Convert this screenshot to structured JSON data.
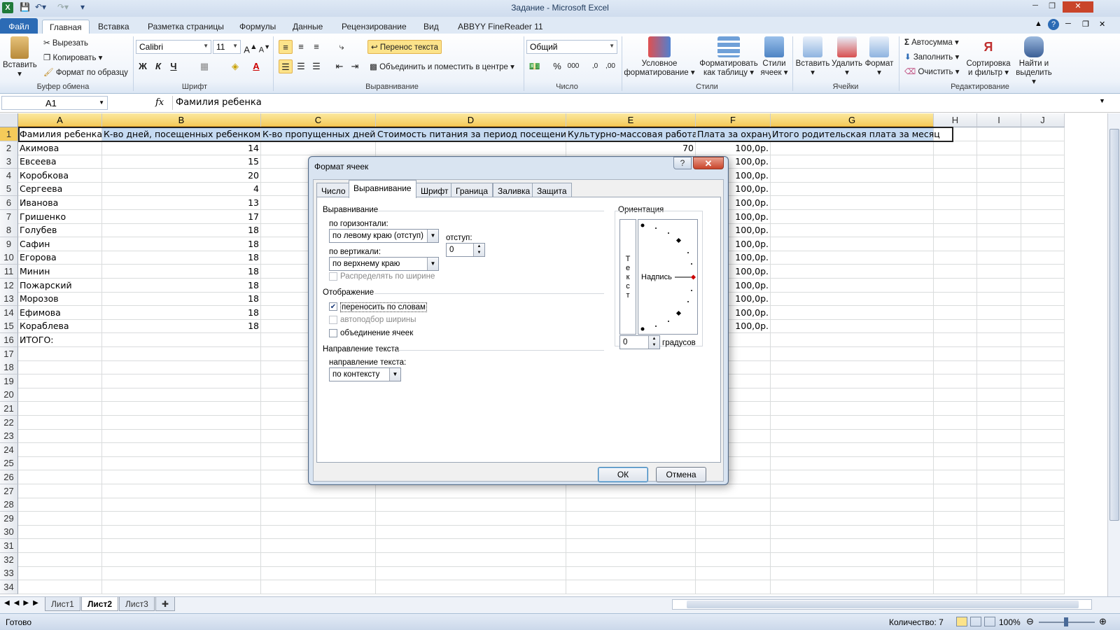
{
  "window": {
    "title": "Задание - Microsoft Excel"
  },
  "ribbon_tabs": [
    "Файл",
    "Главная",
    "Вставка",
    "Разметка страницы",
    "Формулы",
    "Данные",
    "Рецензирование",
    "Вид",
    "ABBYY FineReader 11"
  ],
  "ribbon": {
    "clipboard": {
      "paste": "Вставить",
      "cut": "Вырезать",
      "copy": "Копировать",
      "format_painter": "Формат по образцу",
      "group": "Буфер обмена"
    },
    "font": {
      "name": "Calibri",
      "size": "11",
      "bold": "Ж",
      "italic": "К",
      "underline": "Ч",
      "group": "Шрифт"
    },
    "alignment": {
      "wrap": "Перенос текста",
      "merge": "Объединить и поместить в центре",
      "group": "Выравнивание"
    },
    "number": {
      "format": "Общий",
      "percent": "%",
      "thousands": "000",
      "group": "Число"
    },
    "styles": {
      "conditional": "Условное форматирование",
      "as_table": "Форматировать как таблицу",
      "cell_styles": "Стили ячеек",
      "group": "Стили"
    },
    "cells": {
      "insert": "Вставить",
      "delete": "Удалить",
      "format": "Формат",
      "group": "Ячейки"
    },
    "editing": {
      "autosum": "Автосумма",
      "fill": "Заполнить",
      "clear": "Очистить",
      "sort": "Сортировка и фильтр",
      "find": "Найти и выделить",
      "group": "Редактирование"
    }
  },
  "formula_bar": {
    "name_box": "A1",
    "fx": "fx",
    "value": "Фамилия ребенка"
  },
  "columns": [
    "A",
    "B",
    "C",
    "D",
    "E",
    "F",
    "G",
    "H",
    "I",
    "J"
  ],
  "header_row": [
    "Фамилия ребенка",
    "К-во дней, посещенных ребенком",
    "К-во пропущенных дней",
    "Стоимость питания за период посещения",
    "Культурно-массовая работа",
    "Плата за охрану",
    "Итого родительская плата за месяц"
  ],
  "rows": [
    {
      "name": "Акимова",
      "days": "14",
      "culture": "70",
      "guard": "100,0р."
    },
    {
      "name": "Евсеева",
      "days": "15",
      "culture": "",
      "guard": "100,0р."
    },
    {
      "name": "Коробкова",
      "days": "20",
      "culture": "",
      "guard": "100,0р."
    },
    {
      "name": "Сергеева",
      "days": "4",
      "culture": "",
      "guard": "100,0р."
    },
    {
      "name": "Иванова",
      "days": "13",
      "culture": "",
      "guard": "100,0р."
    },
    {
      "name": "Гришенко",
      "days": "17",
      "culture": "",
      "guard": "100,0р."
    },
    {
      "name": "Голубев",
      "days": "18",
      "culture": "",
      "guard": "100,0р."
    },
    {
      "name": "Сафин",
      "days": "18",
      "culture": "",
      "guard": "100,0р."
    },
    {
      "name": "Егорова",
      "days": "18",
      "culture": "",
      "guard": "100,0р."
    },
    {
      "name": "Минин",
      "days": "18",
      "culture": "",
      "guard": "100,0р."
    },
    {
      "name": "Пожарский",
      "days": "18",
      "culture": "",
      "guard": "100,0р."
    },
    {
      "name": "Морозов",
      "days": "18",
      "culture": "",
      "guard": "100,0р."
    },
    {
      "name": "Ефимова",
      "days": "18",
      "culture": "",
      "guard": "100,0р."
    },
    {
      "name": "Кораблева",
      "days": "18",
      "culture": "",
      "guard": "100,0р."
    }
  ],
  "total_label": "ИТОГО:",
  "row_numbers": [
    "1",
    "2",
    "3",
    "4",
    "5",
    "6",
    "7",
    "8",
    "9",
    "10",
    "11",
    "12",
    "13",
    "14",
    "15",
    "16",
    "17",
    "18",
    "19",
    "20",
    "21",
    "22",
    "23",
    "24",
    "25",
    "26",
    "27",
    "28",
    "29",
    "30",
    "31",
    "32",
    "33",
    "34"
  ],
  "sheets": [
    "Лист1",
    "Лист2",
    "Лист3"
  ],
  "status": {
    "ready": "Готово",
    "count": "Количество: 7",
    "zoom": "100%"
  },
  "dialog": {
    "title": "Формат ячеек",
    "tabs": [
      "Число",
      "Выравнивание",
      "Шрифт",
      "Граница",
      "Заливка",
      "Защита"
    ],
    "alignment_section": "Выравнивание",
    "horizontal_label": "по горизонтали:",
    "horizontal_value": "по левому краю (отступ)",
    "indent_label": "отступ:",
    "indent_value": "0",
    "vertical_label": "по вертикали:",
    "vertical_value": "по верхнему краю",
    "distribute": "Распределять по ширине",
    "display_section": "Отображение",
    "wrap_text": "переносить по словам",
    "shrink": "автоподбор ширины",
    "merge": "объединение ячеек",
    "direction_section": "Направление текста",
    "direction_label": "направление текста:",
    "direction_value": "по контексту",
    "orientation_section": "Ориентация",
    "vertical_text": [
      "Т",
      "е",
      "к",
      "с",
      "т"
    ],
    "orientation_label": "Надпись",
    "degrees_value": "0",
    "degrees_label": "градусов",
    "ok": "ОК",
    "cancel": "Отмена"
  }
}
